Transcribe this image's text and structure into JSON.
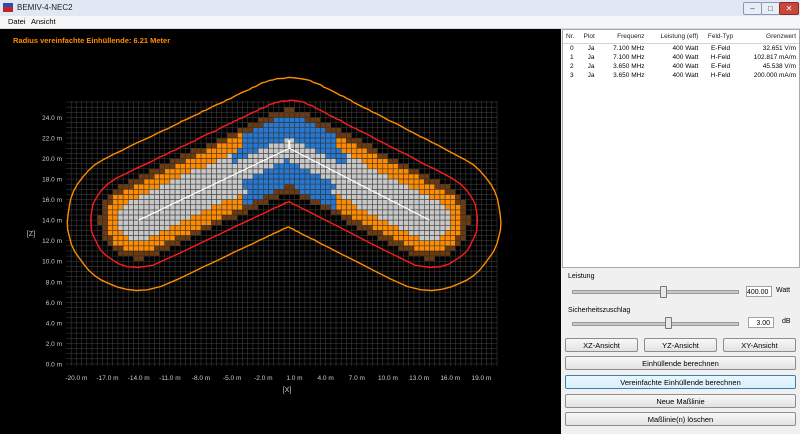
{
  "window": {
    "title": "BEMIV-4-NEC2",
    "min": "–",
    "max": "□",
    "close": "✕"
  },
  "menu": [
    {
      "label": "Datei"
    },
    {
      "label": "Ansicht"
    }
  ],
  "plot": {
    "title": "Radius vereinfachte Einhüllende: 6.21 Meter",
    "x_axis_label": "[X]",
    "y_axis_label": "[Z]",
    "x_ticks": [
      "-20.0 m",
      "-17.0 m",
      "-14.0 m",
      "-11.0 m",
      "-8.0 m",
      "-5.0 m",
      "-2.0 m",
      "1.0 m",
      "4.0 m",
      "7.0 m",
      "10.0 m",
      "13.0 m",
      "16.0 m",
      "19.0 m"
    ],
    "y_ticks": [
      "24.0 m",
      "22.0 m",
      "20.0 m",
      "18.0 m",
      "16.0 m",
      "14.0 m",
      "12.0 m",
      "10.0 m",
      "8.0 m",
      "6.0 m",
      "4.0 m",
      "2.0 m",
      "0.0 m"
    ],
    "colors": {
      "orange": "#ff8c00",
      "red": "#ff1a1a",
      "grey": "#c8c8c8",
      "blue": "#2878d0",
      "brown": "#6b3a10",
      "grid": "#555555",
      "antenna": "#ffffff"
    }
  },
  "table": {
    "headers": [
      "Nr.",
      "Plot",
      "Frequenz",
      "Leistung (eff)",
      "Feld-Typ",
      "Grenzwert"
    ],
    "rows": [
      [
        "0",
        "Ja",
        "7.100 MHz",
        "400 Watt",
        "E-Feld",
        "32.651 V/m"
      ],
      [
        "1",
        "Ja",
        "7.100 MHz",
        "400 Watt",
        "H-Feld",
        "102.817 mA/m"
      ],
      [
        "2",
        "Ja",
        "3.650 MHz",
        "400 Watt",
        "E-Feld",
        "45.538 V/m"
      ],
      [
        "3",
        "Ja",
        "3.650 MHz",
        "400 Watt",
        "H-Feld",
        "200.000 mA/m"
      ]
    ]
  },
  "controls": {
    "power_label": "Leistung",
    "power_value": "400.00",
    "power_unit": "Watt",
    "power_slider_level": 0.55,
    "safety_label": "Sicherheitszuschlag",
    "safety_value": "3.00",
    "safety_unit": "dB",
    "safety_slider_level": 0.58,
    "btn_xz": "XZ-Ansicht",
    "btn_yz": "YZ-Ansicht",
    "btn_xy": "XY-Ansicht",
    "btn_envelope": "Einhüllende berechnen",
    "btn_simple_envelope": "Vereinfachte Einhüllende berechnen",
    "btn_new_line": "Neue Maßlinie",
    "btn_delete_lines": "Maßlinie(n) löschen"
  }
}
